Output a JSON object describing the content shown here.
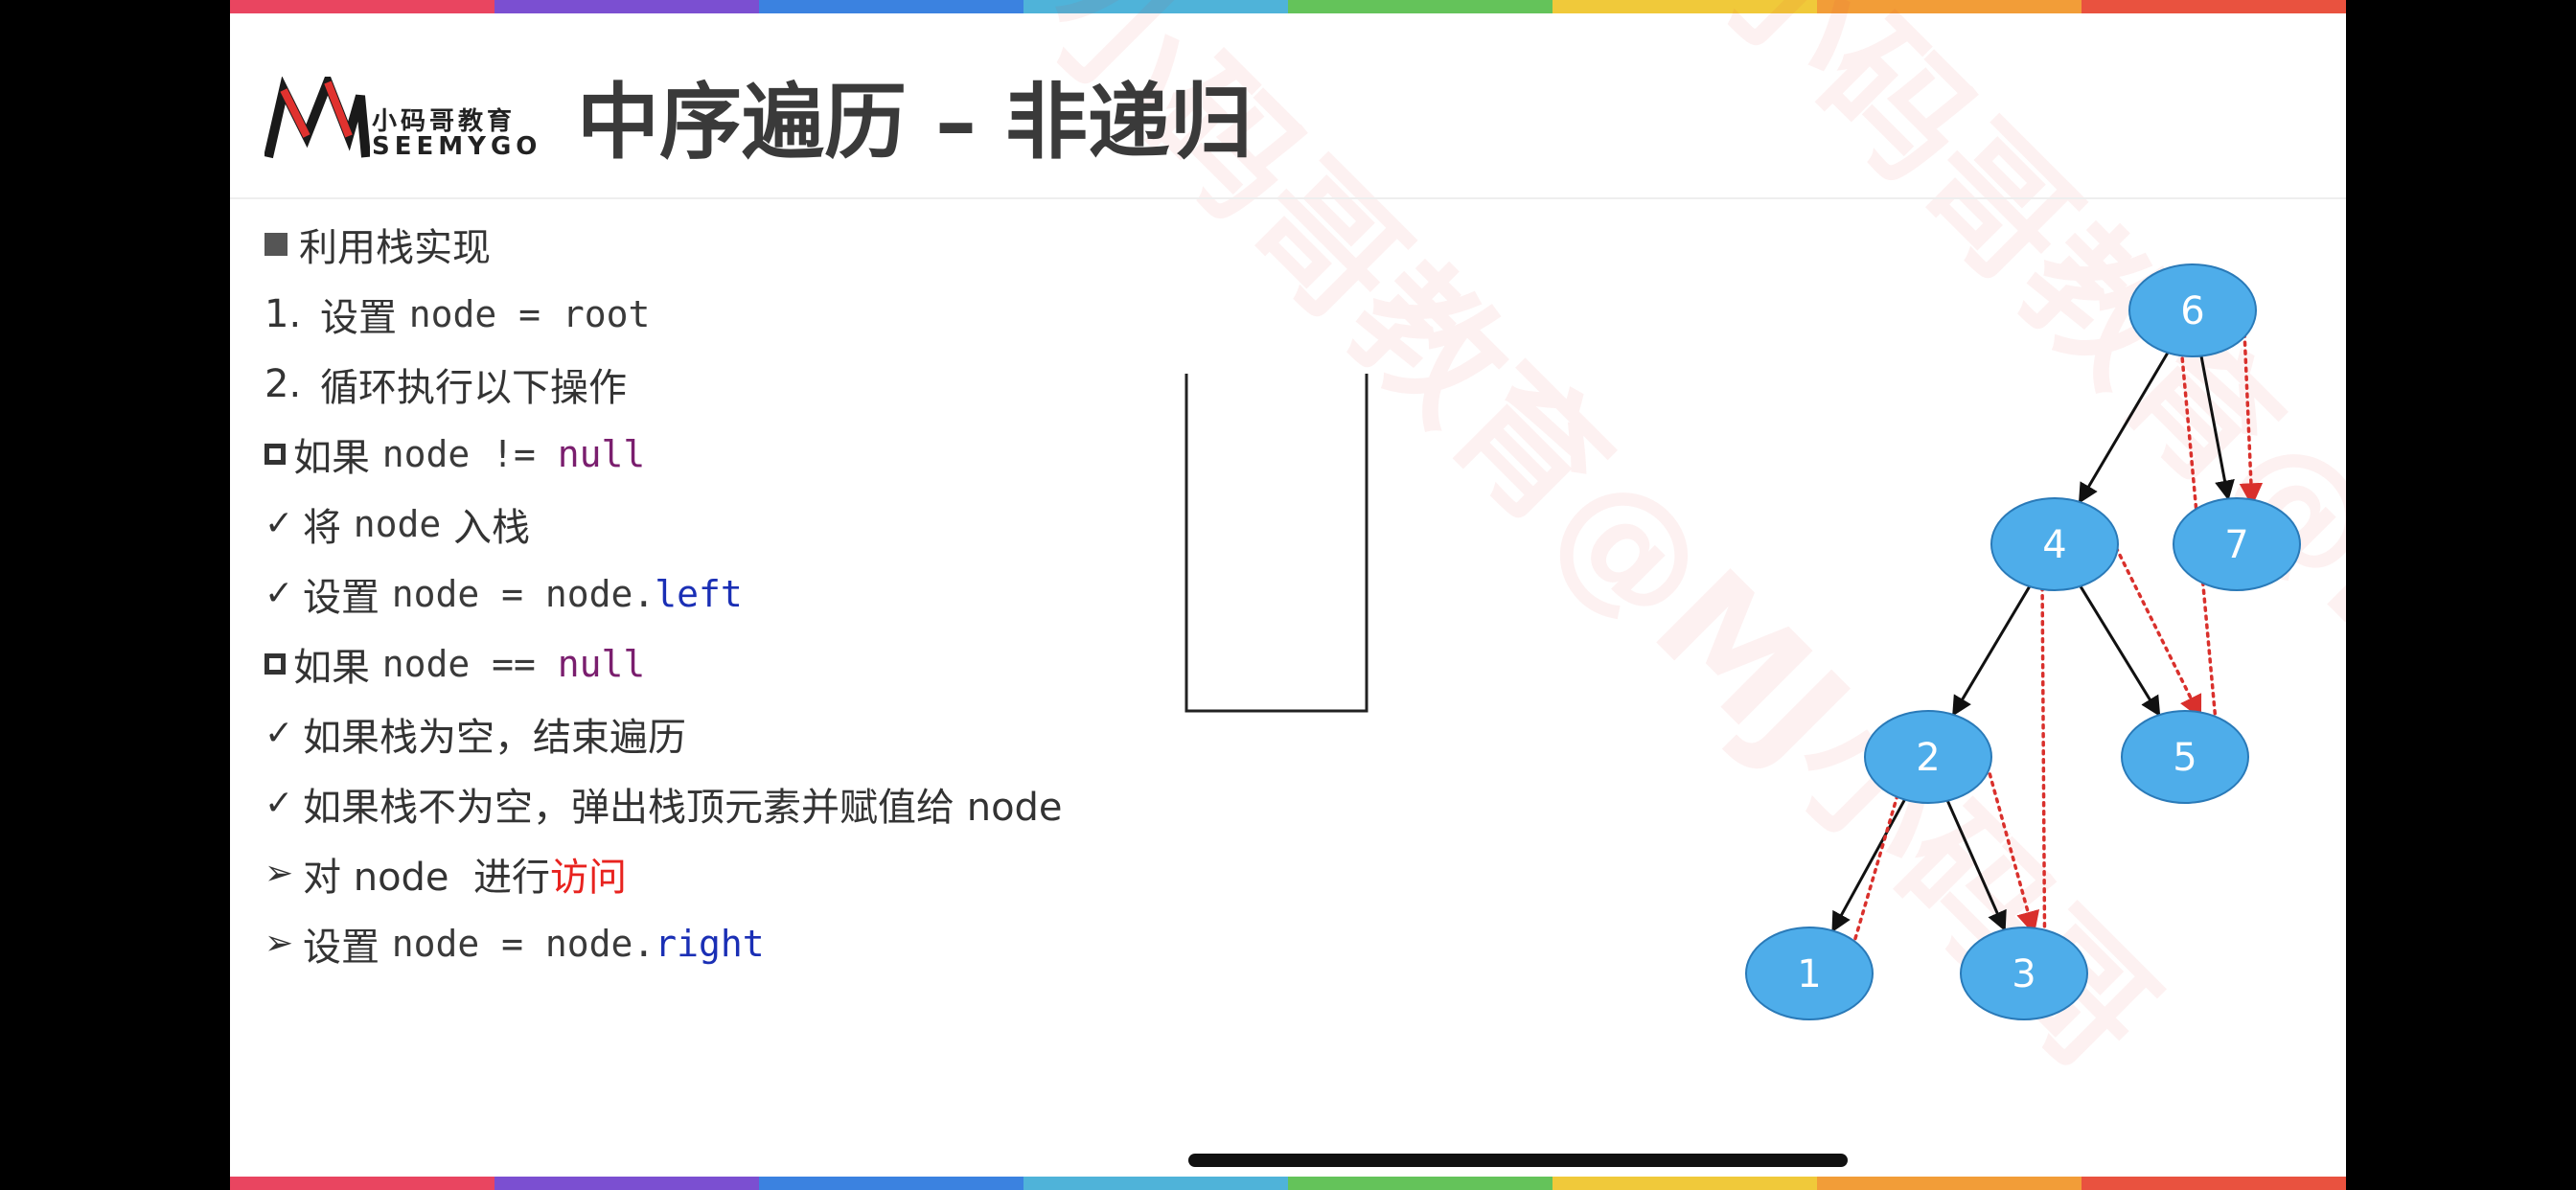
{
  "colors": {
    "rainbow": [
      "#e94560",
      "#7b4fd1",
      "#3b82e0",
      "#4fb3d9",
      "#64c35a",
      "#f0c93a",
      "#f29d38",
      "#e9523f"
    ],
    "node_fill": "#4eadea",
    "node_stroke": "#2a7ab8",
    "keyword_purple": "#7a1e6e",
    "keyword_blue": "#1a2fb5",
    "accent_red": "#e8231f",
    "trace_red": "#d9302c"
  },
  "logo": {
    "cn": "小码哥教育",
    "en": "SEEMYGO"
  },
  "title": "中序遍历 – 非递归",
  "lines": [
    {
      "marker": "square",
      "text": "利用栈实现"
    },
    {
      "marker": "1.",
      "text": "设置 ",
      "code": "node = root"
    },
    {
      "marker": "2.",
      "text": "循环执行以下操作"
    },
    {
      "marker": "hollow",
      "text": "如果 ",
      "code": "node != ",
      "kw": "null"
    },
    {
      "marker": "✓",
      "text": "将 ",
      "code": "node",
      "text2": " 入栈"
    },
    {
      "marker": "✓",
      "text": "设置 ",
      "code": "node = node.",
      "kw": "left"
    },
    {
      "marker": "hollow",
      "text": "如果 ",
      "code": "node == ",
      "kw": "null"
    },
    {
      "marker": "✓",
      "text": "如果栈为空，结束遍历"
    },
    {
      "marker": "✓",
      "text": "如果栈不为空，弹出栈顶元素并赋值给 node"
    },
    {
      "marker": "➢",
      "text": "对 node  进行",
      "red": "访问"
    },
    {
      "marker": "➢",
      "text": "设置 ",
      "code": "node = node.",
      "kw": "right"
    }
  ],
  "tree": {
    "nodes": [
      "6",
      "4",
      "7",
      "2",
      "5",
      "1",
      "3"
    ]
  },
  "watermark": "小码哥教育@MJ小码哥"
}
